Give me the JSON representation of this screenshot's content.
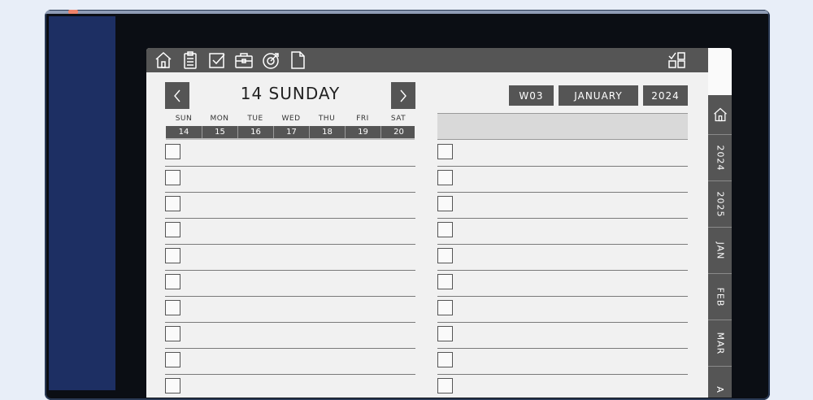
{
  "toolbar": {
    "icons": [
      "home-icon",
      "clipboard-icon",
      "checkbox-icon",
      "briefcase-icon",
      "goal-icon",
      "page-icon"
    ],
    "right_icon": "checklist-grid-icon"
  },
  "day_header": {
    "title": "14 SUNDAY"
  },
  "pills": {
    "week": "W03",
    "month": "JANUARY",
    "year": "2024"
  },
  "week": {
    "days": [
      "SUN",
      "MON",
      "TUE",
      "WED",
      "THU",
      "FRI",
      "SAT"
    ],
    "dates": [
      "14",
      "15",
      "16",
      "17",
      "18",
      "19",
      "20"
    ]
  },
  "side_tabs": [
    "2024",
    "2025",
    "JAN",
    "FEB",
    "MAR",
    "A"
  ],
  "colors": {
    "dark": "#555555",
    "page": "#f1f1f1",
    "device": "#0b0e14",
    "accent_blue": "#1d2f63"
  }
}
